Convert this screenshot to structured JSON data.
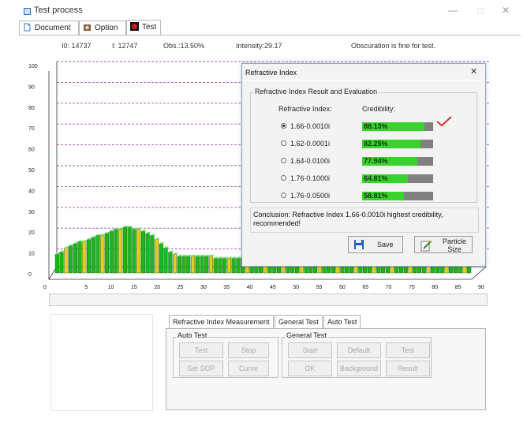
{
  "window": {
    "title": "Test process",
    "minimize": "—",
    "maximize": "□",
    "close": "✕"
  },
  "tabs": [
    {
      "label": "Document"
    },
    {
      "label": "Option"
    },
    {
      "label": "Test"
    }
  ],
  "info": {
    "i0": "I0:  14737",
    "i": "I:  12747",
    "obs": "Obs.:13.50%",
    "intensity": "Intensity:29.17",
    "status": "Obscuration is fine for test."
  },
  "chart_data": {
    "type": "bar",
    "y_ticks": [
      "100",
      "90",
      "80",
      "70",
      "60",
      "50",
      "40",
      "30",
      "20",
      "10",
      "0"
    ],
    "x_ticks": [
      "0",
      "5",
      "10",
      "15",
      "20",
      "25",
      "30",
      "35",
      "40",
      "45",
      "50",
      "55",
      "60",
      "65",
      "70",
      "75",
      "80",
      "85",
      "90"
    ],
    "ylim": [
      0,
      100
    ],
    "grid": "dashed-horizontal",
    "colors": {
      "bar": "#1fb51f",
      "bar_accent": "#e3cf1d",
      "grid": "#b04ab8"
    },
    "values": [
      9,
      10,
      12,
      13,
      14,
      15,
      15,
      16,
      17,
      18,
      18,
      19,
      20,
      21,
      21,
      22,
      22,
      21,
      21,
      20,
      19,
      18,
      16,
      14,
      12,
      10,
      9,
      8,
      8,
      8,
      8,
      8,
      8,
      8,
      8,
      7,
      7,
      7,
      7,
      7,
      7,
      7,
      6,
      6,
      6,
      6,
      6,
      6,
      6,
      6,
      6,
      6,
      5,
      5,
      5,
      5,
      5,
      5,
      5,
      5,
      5,
      5,
      5,
      5,
      5,
      5,
      5,
      5,
      5,
      5,
      5,
      5,
      5,
      5,
      5,
      5,
      5,
      5,
      5,
      5,
      5,
      5,
      5,
      5,
      5,
      5,
      5,
      5,
      5,
      4,
      4,
      4
    ]
  },
  "dialog": {
    "title": "Refractive Index",
    "close": "✕",
    "group_title": "Refractive Index Result and Evaluation",
    "col_index": "Refractive Index:",
    "col_cred": "Credibility:",
    "rows": [
      {
        "label": "1.66-0.0010i",
        "cred": "88.13%",
        "value": 88.13,
        "selected": true
      },
      {
        "label": "1.62-0.0001i",
        "cred": "82.25%",
        "value": 82.25,
        "selected": false
      },
      {
        "label": "1.64-0.0100i",
        "cred": "77.94%",
        "value": 77.94,
        "selected": false
      },
      {
        "label": "1.76-0.1000i",
        "cred": "64.81%",
        "value": 64.81,
        "selected": false
      },
      {
        "label": "1.76-0.0500i",
        "cred": "58.81%",
        "value": 58.81,
        "selected": false
      }
    ],
    "conclusion": "Conclusion: Refractive Index 1.66-0.0010i highest credibility, recommended!",
    "save": "Save",
    "particle_size": "Particle Size"
  },
  "bottom_tabs": [
    {
      "label": "Refractive Index Measurement"
    },
    {
      "label": "General Test"
    },
    {
      "label": "Auto Test"
    }
  ],
  "auto_test": {
    "title": "Auto Test",
    "buttons": [
      "Test",
      "Stop",
      "Set SOP",
      "Curve"
    ]
  },
  "general_test": {
    "title": "General Test",
    "buttons": [
      "Start",
      "Default",
      "Test",
      "OK",
      "Background",
      "Result"
    ]
  }
}
